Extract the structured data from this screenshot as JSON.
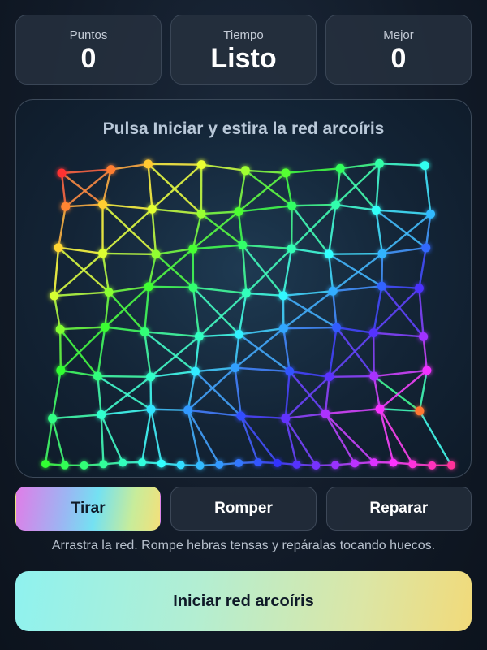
{
  "stats": [
    {
      "label": "Puntos",
      "value": "0"
    },
    {
      "label": "Tiempo",
      "value": "Listo"
    },
    {
      "label": "Mejor",
      "value": "0"
    }
  ],
  "board": {
    "title": "Pulsa Iniciar y estira la red arcoíris"
  },
  "modes": [
    {
      "label": "Tirar",
      "active": true
    },
    {
      "label": "Romper",
      "active": false
    },
    {
      "label": "Reparar",
      "active": false
    }
  ],
  "hint": "Arrastra la red. Rompe hebras tensas y repáralas tocando huecos.",
  "start_label": "Iniciar red arcoíris",
  "colors": {
    "active_gradient": [
      "#e07de8",
      "#74e1f2",
      "#f3e07a"
    ],
    "start_gradient": [
      "#8ff2ef",
      "#f1da7a"
    ]
  }
}
